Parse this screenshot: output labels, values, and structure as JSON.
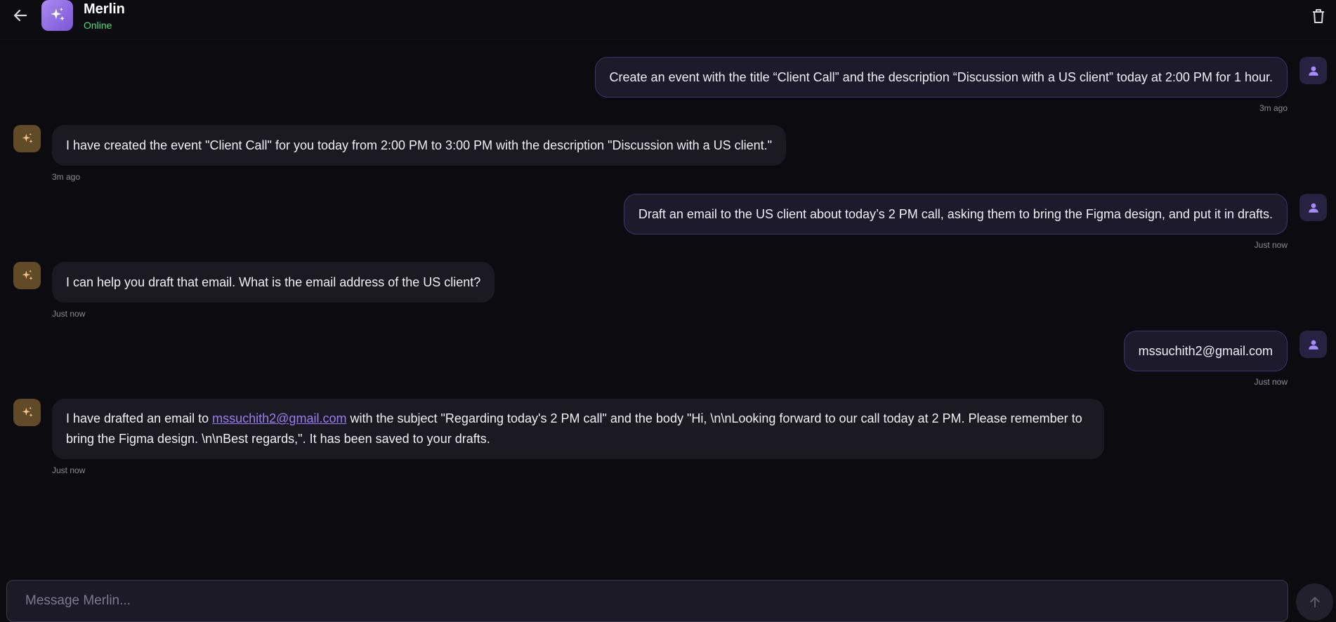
{
  "header": {
    "back_icon": "arrow-left-icon",
    "app_icon": "sparkles-icon",
    "title": "Merlin",
    "status": "Online",
    "status_color": "#4ade80",
    "delete_icon": "trash-icon"
  },
  "messages": [
    {
      "role": "user",
      "text": "Create an event with the title “Client Call” and the description “Discussion with a US client” today at 2:00 PM for 1 hour.",
      "time": "3m ago"
    },
    {
      "role": "assistant",
      "text": "I have created the event \"Client Call\" for you today from 2:00 PM to 3:00 PM with the description \"Discussion with a US client.\"",
      "time": "3m ago"
    },
    {
      "role": "user",
      "text": "Draft an email to the US client about today’s 2 PM call, asking them to bring the Figma design, and put it in drafts.",
      "time": "Just now"
    },
    {
      "role": "assistant",
      "text": "I can help you draft that email. What is the email address of the US client?",
      "time": "Just now"
    },
    {
      "role": "user",
      "text": "mssuchith2@gmail.com",
      "time": "Just now"
    },
    {
      "role": "assistant",
      "text_before_link": "I have drafted an email to ",
      "link": "mssuchith2@gmail.com",
      "text_after_link": " with the subject \"Regarding today's 2 PM call\" and the body \"Hi, \\n\\nLooking forward to our call today at 2 PM. Please remember to bring the Figma design. \\n\\nBest regards,\". It has been saved to your drafts.",
      "time": "Just now"
    }
  ],
  "composer": {
    "placeholder": "Message Merlin...",
    "value": "",
    "send_icon": "arrow-up-icon"
  },
  "colors": {
    "accent": "#9b7ff0",
    "user_bubble_border": "#3e3470",
    "bot_avatar_bg": "#604a28"
  }
}
